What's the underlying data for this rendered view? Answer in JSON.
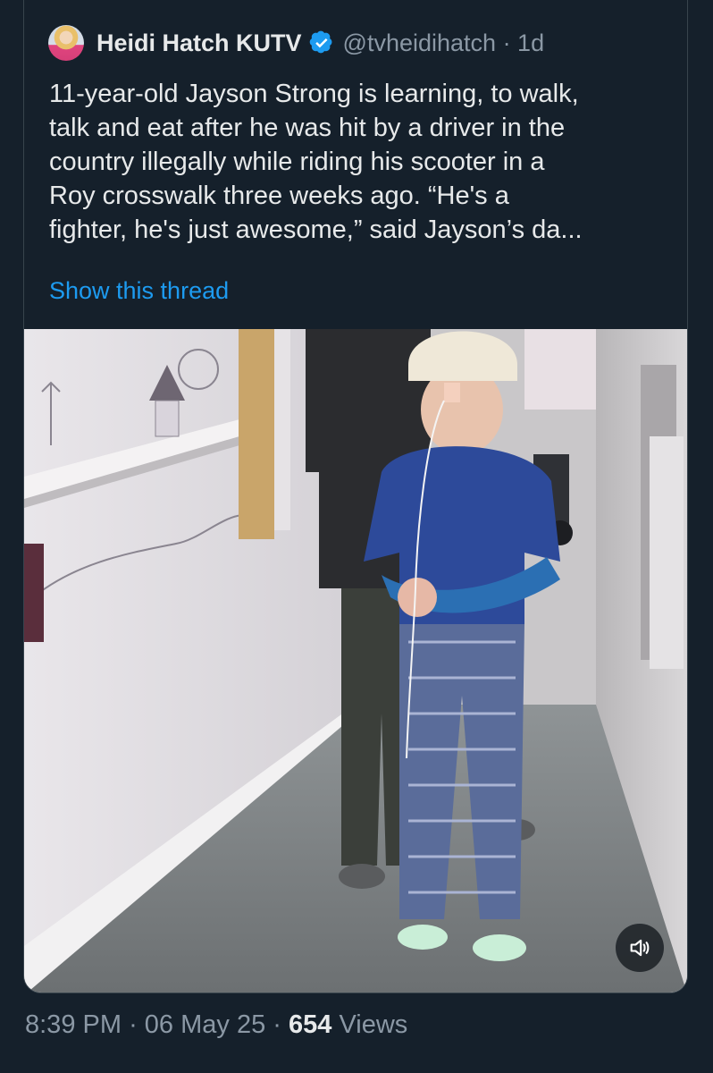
{
  "tweet": {
    "author_name": "Heidi Hatch KUTV",
    "handle": "@tvheidihatch",
    "time_ago": "· 1d",
    "text": "11-year-old Jayson Strong is learning, to walk,\ntalk and eat after he was hit by a driver in the\ncountry illegally while riding his scooter in a\nRoy crosswalk three weeks ago. “He's a\nfighter, he's just awesome,” said Jayson’s da...",
    "show_thread": "Show this thread"
  },
  "media": {
    "volume_icon": "speaker-volume-icon"
  },
  "footer": {
    "time": "8:39 PM",
    "date": "06 May 25",
    "views_count": "654",
    "views_label": "Views"
  },
  "colors": {
    "background": "#15202b",
    "link": "#1d9bf0",
    "muted": "#8b98a5",
    "verified": "#1d9bf0"
  }
}
